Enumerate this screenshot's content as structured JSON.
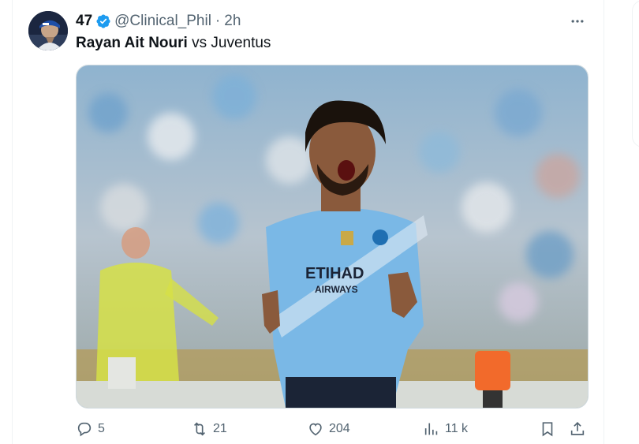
{
  "tweet": {
    "display_name": "47",
    "handle": "@Clinical_Phil",
    "separator": "·",
    "time": "2h",
    "text_bold": "Rayan Ait Nouri",
    "text_rest": " vs Juventus"
  },
  "icons": {
    "verified": "verified-badge-icon",
    "more": "more-horizontal-icon",
    "reply": "reply-icon",
    "repost": "repost-icon",
    "like": "heart-icon",
    "views": "views-icon",
    "bookmark": "bookmark-icon",
    "share": "share-icon"
  },
  "actions": {
    "replies": "5",
    "reposts": "21",
    "likes": "204",
    "views": "11 k"
  },
  "colors": {
    "verified": "#1d9bf0",
    "muted": "#536471",
    "jersey": "#7ab8e6"
  }
}
